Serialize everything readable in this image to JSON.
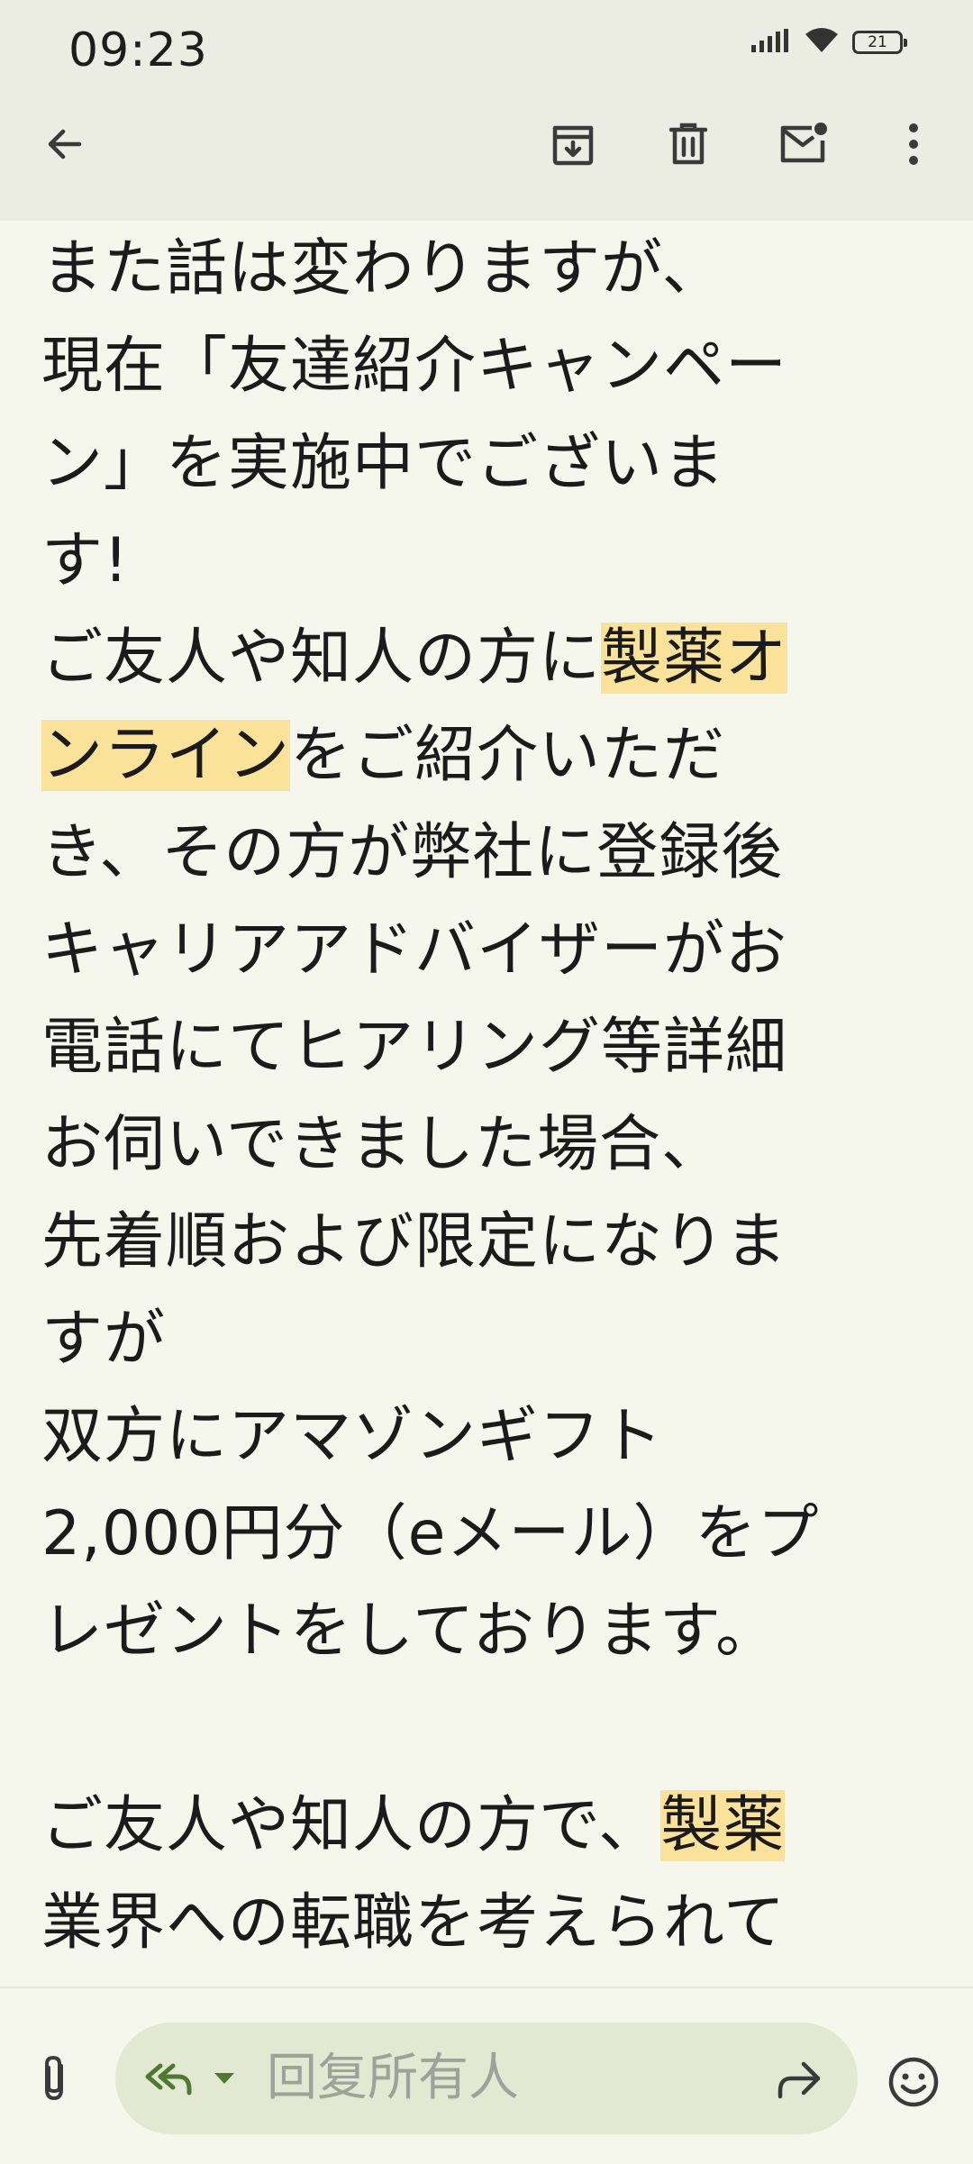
{
  "status_bar": {
    "time": "09:23",
    "battery_level": "21",
    "icons": [
      "signal-icon",
      "wifi-icon",
      "battery-icon"
    ]
  },
  "toolbar": {
    "icons": [
      "back-arrow-icon",
      "archive-icon",
      "delete-icon",
      "mark-unread-icon",
      "more-options-icon"
    ]
  },
  "email_body": {
    "lines": [
      {
        "text": "また話は変わりますが、"
      },
      {
        "text": "現在「友達紹介キャンペー"
      },
      {
        "text": "ン」を実施中でございま"
      },
      {
        "text": "す!"
      },
      {
        "before": "ご友人や知人の方に",
        "highlight": "製薬オ",
        "after": ""
      },
      {
        "before": "",
        "highlight": "ンライン",
        "after": "をご紹介いただ"
      },
      {
        "text": "き、その方が弊社に登録後"
      },
      {
        "text": "キャリアアドバイザーがお"
      },
      {
        "text": "電話にてヒアリング等詳細"
      },
      {
        "text": "お伺いできました場合、"
      },
      {
        "text": "先着順および限定になりま"
      },
      {
        "text": "すが"
      },
      {
        "text": "双方にアマゾンギフト"
      },
      {
        "text": "2,000円分（eメール）をプ"
      },
      {
        "text": "レゼントをしております。"
      },
      {
        "text": ""
      },
      {
        "before": "ご友人や知人の方で、",
        "highlight": "製薬",
        "after": ""
      },
      {
        "text": "業界への転職を考えられて"
      }
    ],
    "highlight_color": "#fbe29a"
  },
  "reply_bar": {
    "placeholder": "回复所有人",
    "icons": [
      "attachment-icon",
      "reply-all-icon",
      "dropdown-caret-icon",
      "forward-icon",
      "emoji-icon"
    ],
    "accent": "#4c7a2e"
  }
}
